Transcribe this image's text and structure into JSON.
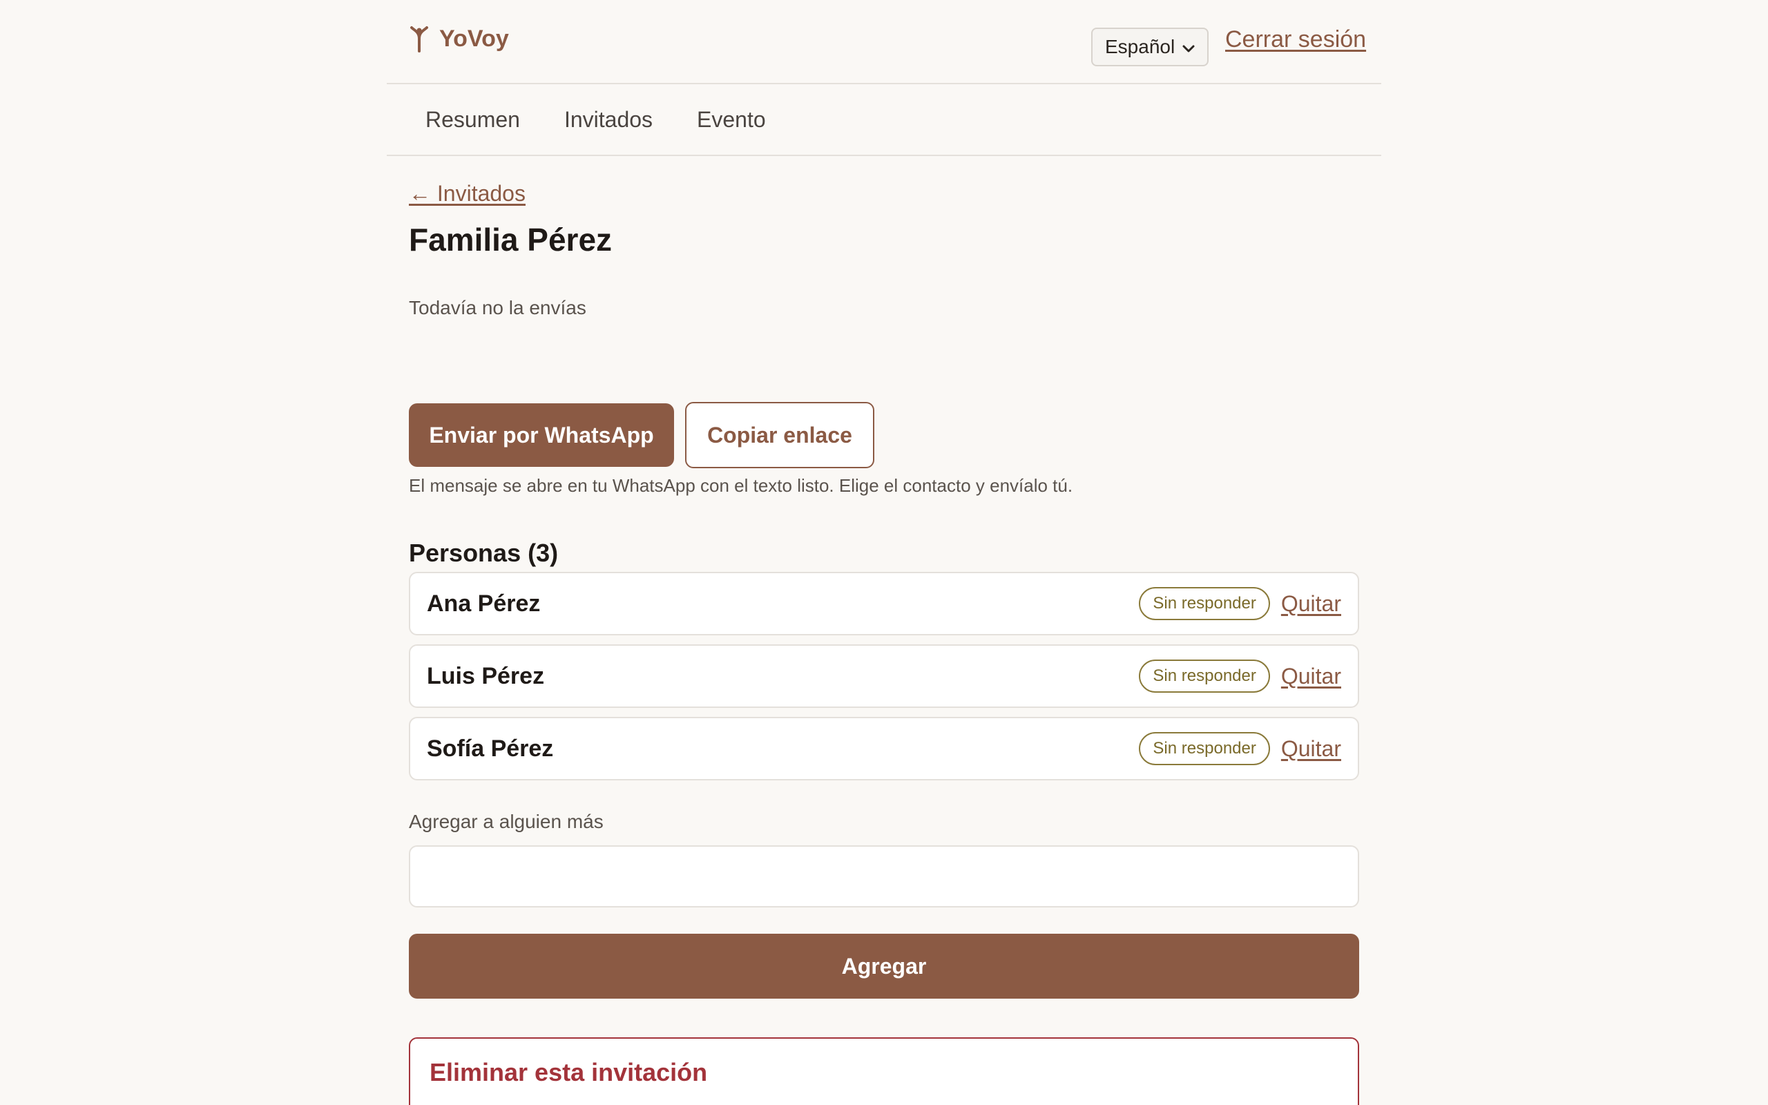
{
  "header": {
    "brand": "YoVoy",
    "language": "Español",
    "logout": "Cerrar sesión"
  },
  "nav": {
    "tabs": [
      {
        "label": "Resumen"
      },
      {
        "label": "Invitados"
      },
      {
        "label": "Evento"
      }
    ]
  },
  "main": {
    "back_link": "← Invitados",
    "title": "Familia Pérez",
    "status": "Todavía no la envías",
    "send_whatsapp": "Enviar por WhatsApp",
    "copy_link": "Copiar enlace",
    "hint": "El mensaje se abre en tu WhatsApp con el texto listo. Elige el contacto y envíalo tú.",
    "people_title": "Personas (3)",
    "people": [
      {
        "name": "Ana Pérez",
        "status": "Sin responder",
        "action": "Quitar"
      },
      {
        "name": "Luis Pérez",
        "status": "Sin responder",
        "action": "Quitar"
      },
      {
        "name": "Sofía Pérez",
        "status": "Sin responder",
        "action": "Quitar"
      }
    ],
    "add_label": "Agregar a alguien más",
    "add_input_value": "",
    "add_button": "Agregar",
    "danger_title": "Eliminar esta invitación"
  },
  "colors": {
    "brand": "#8b5a44",
    "background": "#faf8f5",
    "danger": "#a3333a",
    "badge": "#7a6a2a"
  },
  "icons": {
    "brand": "sprout-icon",
    "select": "chevron-down-icon"
  }
}
